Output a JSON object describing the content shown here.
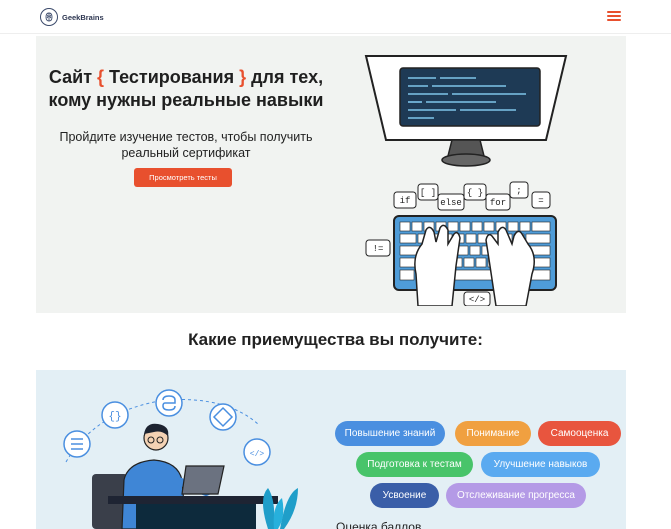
{
  "header": {
    "logo_text": "GeekBrains",
    "menu_icon": "hamburger-menu-icon",
    "accent": "#e8502e"
  },
  "hero": {
    "title_part1": "Сайт ",
    "brace_open": "{",
    "title_highlight": " Тестирования ",
    "brace_close": "}",
    "title_part2": " для тех,",
    "title_line2": "кому нужны реальные навыки",
    "subtitle_line1": "Пройдите изучение тестов, чтобы получить",
    "subtitle_line2": "реальный сертификат",
    "button_label": "Просмотреть тесты",
    "keywords": [
      "if",
      "[ ]",
      "else",
      "{ }",
      "for",
      ";",
      "=",
      "!=",
      "</>"
    ]
  },
  "benefits": {
    "title": "Какие приемущества вы получите:",
    "pills": [
      {
        "label": "Повышение знаний",
        "color": "#4a8fe0"
      },
      {
        "label": "Понимание",
        "color": "#f0a040"
      },
      {
        "label": "Самооценка",
        "color": "#e8553e"
      },
      {
        "label": "Подготовка к тестам",
        "color": "#48c46a"
      },
      {
        "label": "Улучшение навыков",
        "color": "#5aaaf0"
      },
      {
        "label": "Усвоение",
        "color": "#3a5ea8"
      },
      {
        "label": "Отслеживание прогресса",
        "color": "#b49ae6"
      }
    ],
    "bottom_text_partial": "Оценка баллов"
  }
}
